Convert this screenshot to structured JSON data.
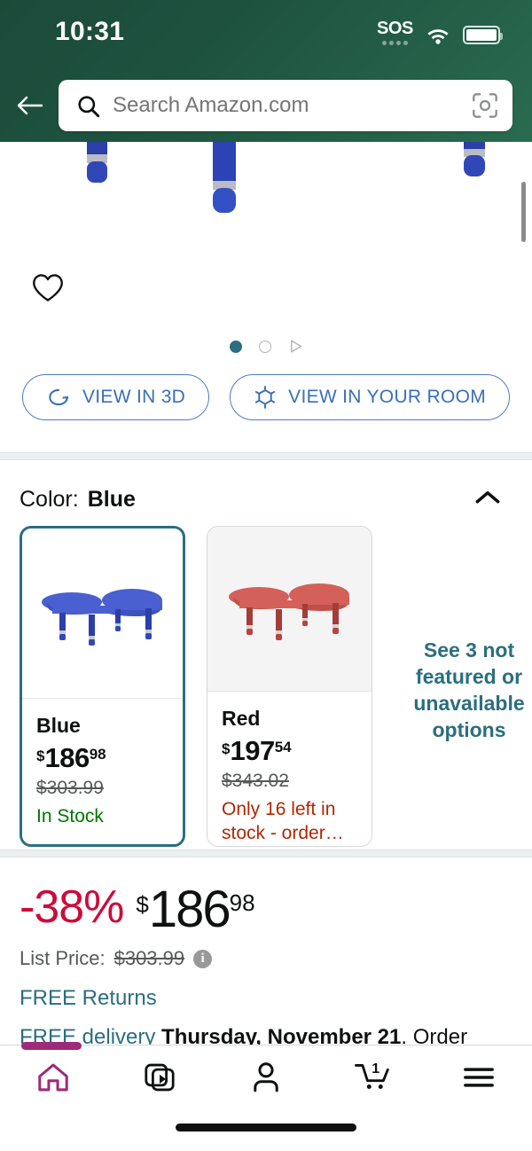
{
  "status_bar": {
    "time": "10:31",
    "sos_label": "SOS",
    "wifi_icon": "wifi-icon",
    "battery_icon": "battery-icon"
  },
  "header": {
    "back_icon": "back-arrow-icon",
    "search_icon": "search-icon",
    "search_placeholder": "Search Amazon.com",
    "search_value": "",
    "camera_icon": "camera-scan-icon",
    "background_color": "#1e5340"
  },
  "gallery": {
    "wishlist_icon": "heart-icon",
    "carousel": {
      "dots": [
        "active",
        "inactive"
      ],
      "video_icon": "play-triangle-icon",
      "active_index": 0,
      "active_color": "#2b6e80"
    },
    "view_3d_button": "VIEW IN 3D",
    "view_3d_icon": "rotate-3d-icon",
    "view_room_button": "VIEW IN YOUR ROOM",
    "view_room_icon": "ar-cube-icon",
    "button_color": "#3a6fb8",
    "scrollbar": "vertical-scrollbar"
  },
  "color_section": {
    "label": "Color:",
    "selected_value": "Blue",
    "collapse_icon": "chevron-up-icon",
    "options": [
      {
        "name": "Blue",
        "price_symbol": "$",
        "price_whole": "186",
        "price_fraction": "98",
        "list_price": "$303.99",
        "stock_text": "In Stock",
        "stock_state": "in-stock",
        "selected": true,
        "swatch_color": "#4557c4"
      },
      {
        "name": "Red",
        "price_symbol": "$",
        "price_whole": "197",
        "price_fraction": "54",
        "list_price": "$343.02",
        "stock_text": "Only 16 left in stock - order…",
        "stock_state": "low-stock",
        "selected": false,
        "swatch_color": "#c4564f"
      }
    ],
    "see_more_link": "See 3 not featured or unavailable options"
  },
  "price_block": {
    "discount": "-38%",
    "price_symbol": "$",
    "price_whole": "186",
    "price_fraction": "98",
    "list_price_label": "List Price:",
    "list_price_value": "$303.99",
    "info_icon": "info-icon",
    "info_glyph": "i",
    "free_returns": "FREE Returns",
    "delivery_link": "FREE delivery",
    "delivery_date": "Thursday, November 21",
    "delivery_tail": ". Order within",
    "discount_color": "#CC0C39",
    "link_color": "#2b6e80"
  },
  "bottom_nav": {
    "active_color": "#9c2c7a",
    "items": [
      {
        "icon": "home-icon",
        "active": true
      },
      {
        "icon": "video-feed-icon",
        "active": false
      },
      {
        "icon": "account-person-icon",
        "active": false
      },
      {
        "icon": "cart-icon",
        "active": false,
        "badge": "1"
      },
      {
        "icon": "menu-hamburger-icon",
        "active": false
      }
    ],
    "home_indicator": "home-indicator-bar"
  }
}
